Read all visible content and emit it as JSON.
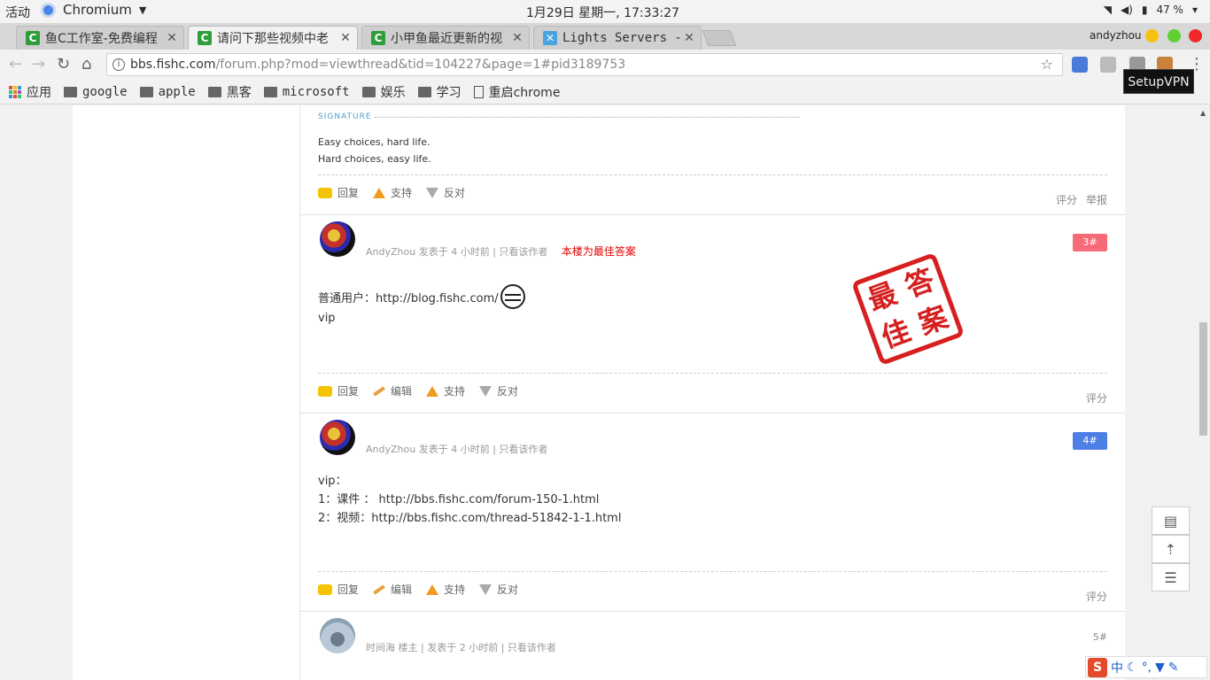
{
  "system": {
    "activities": "活动",
    "app_name": "Chromium",
    "clock": "1月29日 星期一, 17:33:27",
    "battery": "47 %"
  },
  "tabs": [
    {
      "label": "鱼C工作室-免费编程",
      "favicon": "fishc-icon"
    },
    {
      "label": "请问下那些视频中老",
      "favicon": "fishc-icon"
    },
    {
      "label": "小甲鱼最近更新的视",
      "favicon": "fishc-icon"
    },
    {
      "label": "Lights Servers -",
      "favicon": "lights-icon"
    }
  ],
  "profile_name": "andyzhou",
  "omnibox": {
    "host": "bbs.fishc.com",
    "path": "/forum.php?mod=viewthread&tid=104227&page=1#pid3189753"
  },
  "tooltip": "SetupVPN",
  "bookmarks": [
    {
      "label": "应用",
      "icon": "apps-icon"
    },
    {
      "label": "google",
      "icon": "folder-icon"
    },
    {
      "label": "apple",
      "icon": "folder-icon"
    },
    {
      "label": "黑客",
      "icon": "folder-icon"
    },
    {
      "label": "microsoft",
      "icon": "folder-icon"
    },
    {
      "label": "娱乐",
      "icon": "folder-icon"
    },
    {
      "label": "学习",
      "icon": "folder-icon"
    },
    {
      "label": "重启chrome",
      "icon": "page-icon"
    }
  ],
  "signature": {
    "heading": "SIGNATURE",
    "line1": "Easy choices, hard life.",
    "line2": "Hard choices, easy life."
  },
  "labels": {
    "reply": "回复",
    "edit": "编辑",
    "support": "支持",
    "oppose": "反对",
    "rate": "评分",
    "report": "举报",
    "only_author": "只看该作者",
    "best_answer": "本楼为最佳答案"
  },
  "posts": [
    {
      "author": "AndyZhou",
      "posted": "发表于 4 小时前",
      "floor": "3#",
      "floor_color": "#f76b78",
      "line1": "普通用户：http://blog.fishc.com/",
      "line2": "vip"
    },
    {
      "author": "AndyZhou",
      "posted": "发表于 4 小时前",
      "floor": "4#",
      "floor_color": "#4d7fe6",
      "line1": "vip：",
      "line2": "1：课件 ： http://bbs.fishc.com/forum-150-1.html",
      "line3": "2：视频：http://bbs.fishc.com/thread-51842-1-1.html"
    },
    {
      "author": "时间海",
      "role": "楼主",
      "posted": "发表于 2 小时前",
      "floor": "5#"
    }
  ],
  "stamp": [
    "最",
    "答",
    "佳",
    "案"
  ],
  "ime": {
    "logo": "S",
    "mode": "中"
  }
}
